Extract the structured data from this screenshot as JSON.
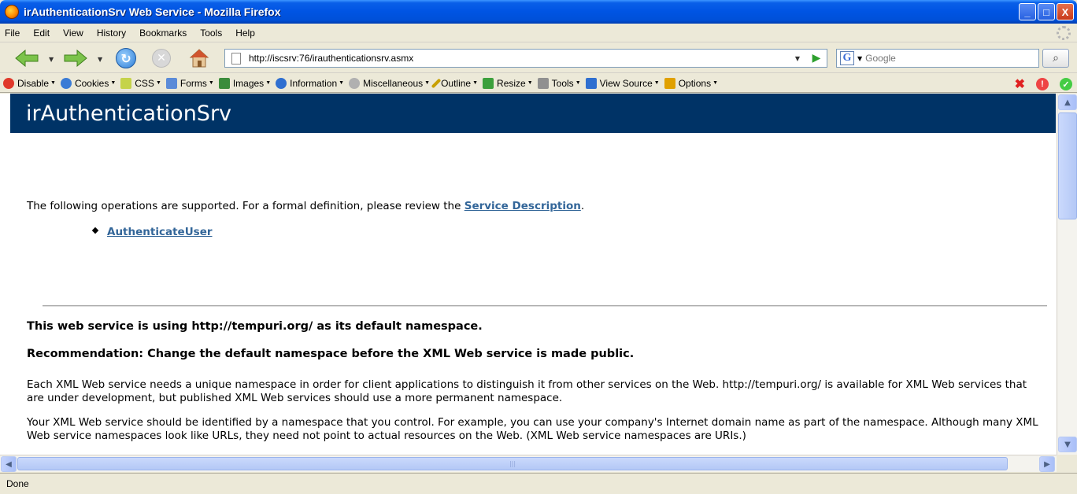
{
  "window": {
    "title": "irAuthenticationSrv Web Service - Mozilla Firefox",
    "buttons": {
      "minimize": "_",
      "maximize": "□",
      "close": "X"
    }
  },
  "menu": [
    "File",
    "Edit",
    "View",
    "History",
    "Bookmarks",
    "Tools",
    "Help"
  ],
  "navbar": {
    "url": "http://iscsrv:76/irauthenticationsrv.asmx",
    "search_placeholder": "Google"
  },
  "devbar": {
    "items": [
      "Disable",
      "Cookies",
      "CSS",
      "Forms",
      "Images",
      "Information",
      "Miscellaneous",
      "Outline",
      "Resize",
      "Tools",
      "View Source",
      "Options"
    ],
    "icon_colors": [
      "#e0392b",
      "#3a7bd5",
      "#c5d34a",
      "#5b8bd8",
      "#3c8c3c",
      "#2f6fd0",
      "#b0b0b0",
      "#c8a000",
      "#3ca03c",
      "#909090",
      "#2f6fd0",
      "#e0a000"
    ]
  },
  "page": {
    "header": "irAuthenticationSrv",
    "intro_text": "The following operations are supported. For a formal definition, please review the ",
    "intro_link": "Service Description",
    "intro_end": ".",
    "operations": [
      "AuthenticateUser"
    ],
    "namespace_heading": "This web service is using http://tempuri.org/ as its default namespace.",
    "recommendation_heading": "Recommendation: Change the default namespace before the XML Web service is made public.",
    "paragraph1": "Each XML Web service needs a unique namespace in order for client applications to distinguish it from other services on the Web. http://tempuri.org/ is available for XML Web services that are under development, but published XML Web services should use a more permanent namespace.",
    "paragraph2": "Your XML Web service should be identified by a namespace that you control. For example, you can use your company's Internet domain name as part of the namespace. Although many XML Web service namespaces look like URLs, they need not point to actual resources on the Web. (XML Web service namespaces are URIs.)"
  },
  "status": "Done"
}
